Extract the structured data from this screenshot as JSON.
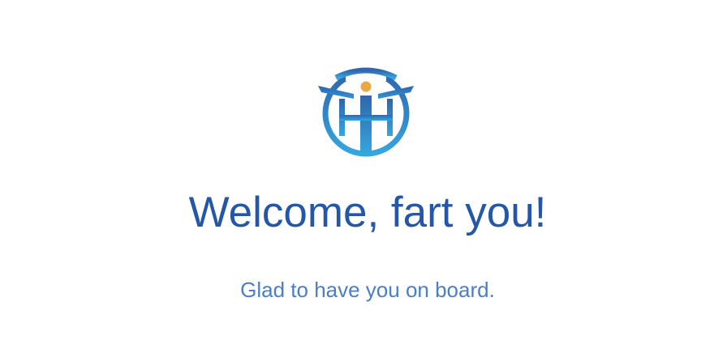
{
  "welcome": {
    "title": "Welcome, fart you!",
    "subtitle": "Glad to have you on board.",
    "logo_icon": "brand-logo-icon"
  },
  "colors": {
    "title": "#2457a8",
    "subtitle": "#4a7fc4",
    "logo_blue_dark": "#2f6fb8",
    "logo_blue_light": "#34a2dc",
    "logo_dot": "#e8a947"
  }
}
